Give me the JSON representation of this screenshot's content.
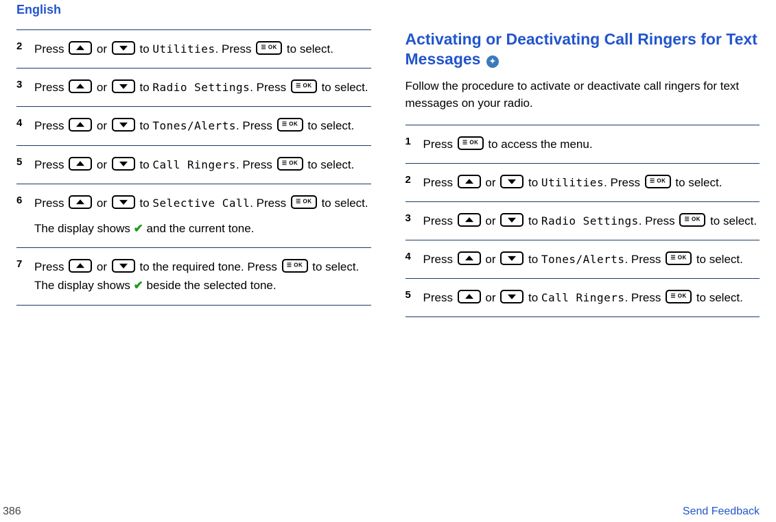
{
  "header": "English",
  "left_steps": [
    {
      "num": "2",
      "parts": [
        "Press ",
        {
          "icon": "up"
        },
        " or ",
        {
          "icon": "down"
        },
        " to ",
        {
          "mono": "Utilities"
        },
        ". Press ",
        {
          "icon": "ok"
        },
        " to select."
      ]
    },
    {
      "num": "3",
      "parts": [
        "Press ",
        {
          "icon": "up"
        },
        " or ",
        {
          "icon": "down"
        },
        " to ",
        {
          "mono": "Radio Settings"
        },
        ". Press ",
        {
          "icon": "ok"
        },
        " to select."
      ]
    },
    {
      "num": "4",
      "parts": [
        "Press ",
        {
          "icon": "up"
        },
        " or ",
        {
          "icon": "down"
        },
        " to ",
        {
          "mono": "Tones/Alerts"
        },
        ". Press ",
        {
          "icon": "ok"
        },
        " to select."
      ]
    },
    {
      "num": "5",
      "parts": [
        "Press ",
        {
          "icon": "up"
        },
        " or ",
        {
          "icon": "down"
        },
        " to ",
        {
          "mono": "Call Ringers"
        },
        ". Press ",
        {
          "icon": "ok"
        },
        " to select."
      ]
    },
    {
      "num": "6",
      "parts": [
        "Press ",
        {
          "icon": "up"
        },
        " or ",
        {
          "icon": "down"
        },
        " to ",
        {
          "mono": "Selective Call"
        },
        ". Press ",
        {
          "icon": "ok"
        },
        " to select."
      ],
      "extra": [
        "The display shows ",
        {
          "check": "✔"
        },
        " and the current tone."
      ]
    },
    {
      "num": "7",
      "parts": [
        "Press ",
        {
          "icon": "up"
        },
        " or ",
        {
          "icon": "down"
        },
        " to the required tone. Press ",
        {
          "icon": "ok"
        },
        " to select. The display shows ",
        {
          "check": "✔"
        },
        " beside the selected tone."
      ]
    }
  ],
  "section_title": "Activating or Deactivating Call Ringers for Text Messages",
  "title_icon_label": "info-icon",
  "intro": "Follow the procedure to activate or deactivate call ringers for text messages on your radio.",
  "right_steps": [
    {
      "num": "1",
      "parts": [
        "Press ",
        {
          "icon": "ok"
        },
        " to access the menu."
      ]
    },
    {
      "num": "2",
      "parts": [
        "Press ",
        {
          "icon": "up"
        },
        " or ",
        {
          "icon": "down"
        },
        " to ",
        {
          "mono": "Utilities"
        },
        ". Press ",
        {
          "icon": "ok"
        },
        " to select."
      ]
    },
    {
      "num": "3",
      "parts": [
        "Press ",
        {
          "icon": "up"
        },
        " or ",
        {
          "icon": "down"
        },
        " to ",
        {
          "mono": "Radio Settings"
        },
        ". Press ",
        {
          "icon": "ok"
        },
        " to select."
      ]
    },
    {
      "num": "4",
      "parts": [
        "Press ",
        {
          "icon": "up"
        },
        " or ",
        {
          "icon": "down"
        },
        " to ",
        {
          "mono": "Tones/Alerts"
        },
        ". Press ",
        {
          "icon": "ok"
        },
        " to select."
      ]
    },
    {
      "num": "5",
      "parts": [
        "Press ",
        {
          "icon": "up"
        },
        " or ",
        {
          "icon": "down"
        },
        " to ",
        {
          "mono": "Call Ringers"
        },
        ". Press ",
        {
          "icon": "ok"
        },
        " to select."
      ]
    }
  ],
  "page_number": "386",
  "feedback_link": "Send Feedback"
}
